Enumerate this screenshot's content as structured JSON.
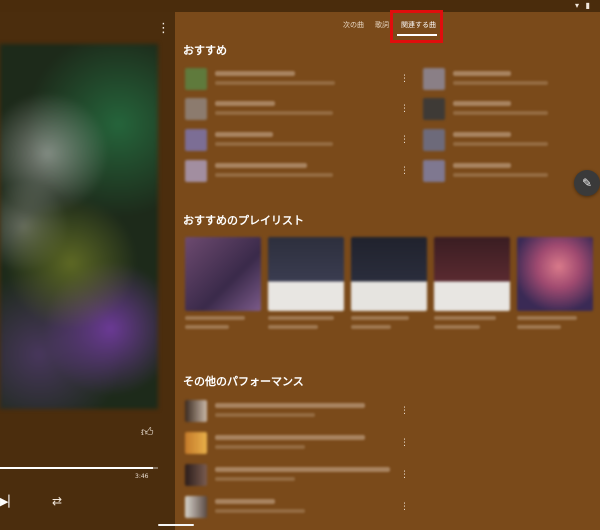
{
  "tabs": [
    {
      "label": "次の曲"
    },
    {
      "label": "歌詞"
    },
    {
      "label": "関連する曲",
      "active": true
    }
  ],
  "sections": {
    "recommended": {
      "title": "おすすめ"
    },
    "playlists": {
      "title": "おすすめのプレイリスト"
    },
    "performances": {
      "title": "その他のパフォーマンス"
    }
  },
  "player": {
    "duration": "3:46",
    "progress_fraction": 0.97
  },
  "icons": {
    "menu": "more-vert-icon",
    "like": "thumb-up-icon",
    "prev": "skip-previous-icon",
    "repeat": "repeat-icon",
    "edit": "pencil-icon",
    "status": "wifi-battery-icons"
  },
  "colors": {
    "background": "#7a4a1a",
    "player_background": "#4b2d0d",
    "highlight": "#e00d0d"
  }
}
